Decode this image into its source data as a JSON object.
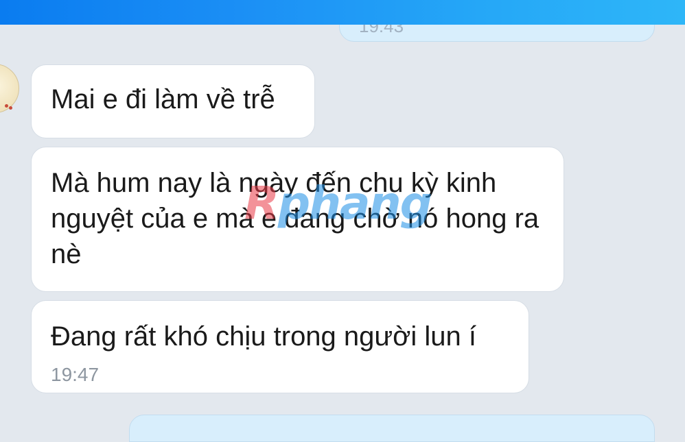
{
  "header": {
    "accent_color": "#1b8ff5"
  },
  "messages": [
    {
      "direction": "outgoing",
      "time": "19:43"
    },
    {
      "direction": "incoming",
      "text": "Mai e đi làm về trễ"
    },
    {
      "direction": "incoming",
      "text": "Mà hum nay là ngày đến chu kỳ kinh nguyệt của e mà e đang chờ nó hong ra nè"
    },
    {
      "direction": "incoming",
      "text": "Đang rất khó chịu trong người lun í",
      "time": "19:47"
    },
    {
      "direction": "outgoing"
    }
  ],
  "contact": {
    "avatar_icon": "avatar-image"
  },
  "watermark": {
    "part1": "R",
    "part2": "phang",
    "colors": [
      "#ea3a46",
      "#1d8fe6"
    ]
  },
  "colors": {
    "background": "#e3e8ee",
    "incoming_bubble": "#ffffff",
    "outgoing_bubble": "#d8eefc",
    "timestamp": "#8d96a0"
  }
}
